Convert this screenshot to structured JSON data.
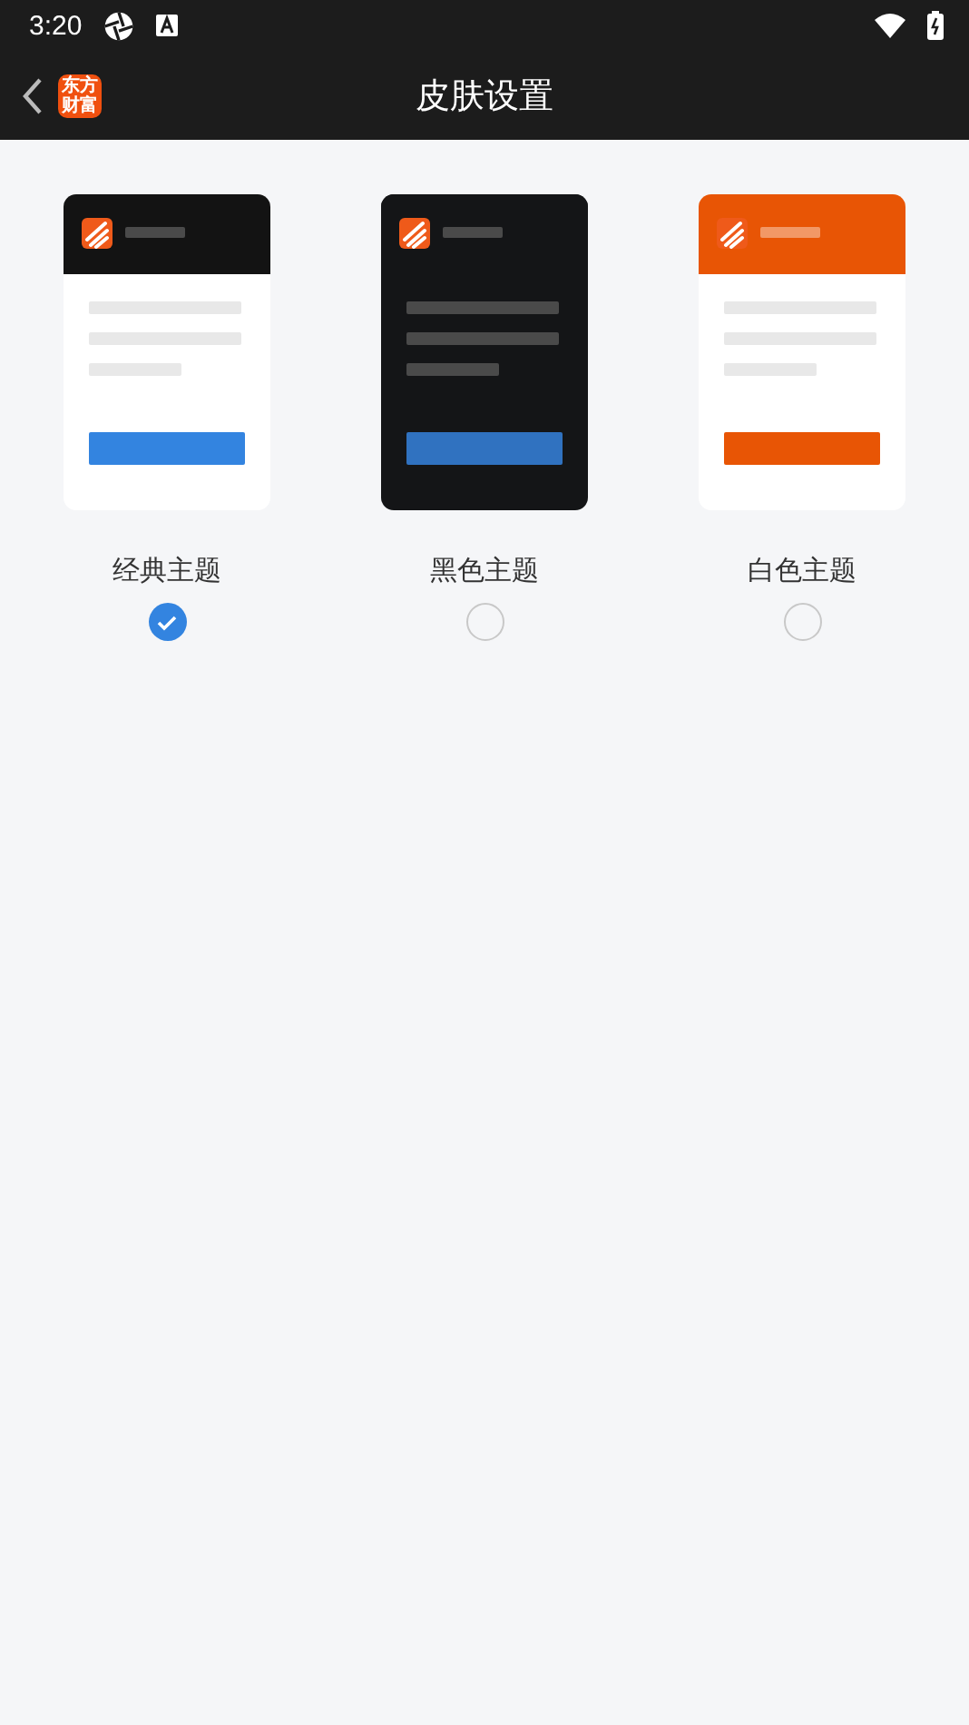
{
  "status_bar": {
    "time": "3:20"
  },
  "header": {
    "logo": "东方财富",
    "title": "皮肤设置"
  },
  "themes": [
    {
      "kind": "classic",
      "label": "经典主题",
      "selected": true
    },
    {
      "kind": "dark",
      "label": "黑色主题",
      "selected": false
    },
    {
      "kind": "orange",
      "label": "白色主题",
      "selected": false
    }
  ]
}
